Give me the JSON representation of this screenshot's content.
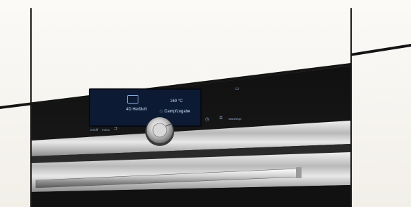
{
  "display": {
    "program": "4D Heißluft",
    "temperature": "160 °C",
    "option": "Dampfzugabe"
  },
  "controls": {
    "left_label_1": "on/off",
    "left_label_2": "menu",
    "right_label": "start/stop"
  },
  "icons": {
    "program": "fan-heating-icon",
    "door": "door-open-icon",
    "steam": "steam-icon",
    "timer": "timer-icon",
    "light": "light-icon",
    "tank": "water-tank-icon"
  },
  "colors": {
    "wall": "#f7f5f1",
    "cabinet_dark": "#151515",
    "display_bg": "#0d1a33",
    "display_text": "#cfe3ff",
    "steel": "#c9c9c9"
  }
}
